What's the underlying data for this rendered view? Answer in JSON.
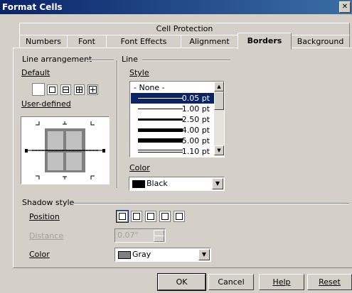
{
  "window": {
    "title": "Format Cells",
    "close_glyph": "✕"
  },
  "tabs_top": [
    {
      "label": "Cell Protection"
    }
  ],
  "tabs": [
    {
      "label": "Numbers"
    },
    {
      "label": "Font"
    },
    {
      "label": "Font Effects"
    },
    {
      "label": "Alignment"
    },
    {
      "label": "Borders",
      "active": true
    },
    {
      "label": "Background"
    }
  ],
  "line_arrangement": {
    "group_label": "Line arrangement",
    "default_label": "Default",
    "user_defined_label": "User-defined",
    "presets": [
      "none",
      "box",
      "top-bottom",
      "all",
      "outer-inner"
    ]
  },
  "line": {
    "group_label": "Line",
    "style_label": "Style",
    "styles": [
      {
        "label": "- None -"
      },
      {
        "label": "0.05 pt",
        "selected": true
      },
      {
        "label": "1.00 pt"
      },
      {
        "label": "2.50 pt"
      },
      {
        "label": "4.00 pt"
      },
      {
        "label": "5.00 pt"
      },
      {
        "label": "1.10 pt"
      }
    ],
    "color_label": "Color",
    "color_value": "Black",
    "color_hex": "#000000"
  },
  "shadow": {
    "group_label": "Shadow style",
    "position_label": "Position",
    "positions": [
      "none",
      "bottom-right",
      "top-right",
      "bottom-left",
      "top-left"
    ],
    "distance_label": "Distance",
    "distance_value": "0.07\"",
    "color_label": "Color",
    "color_value": "Gray",
    "color_hex": "#808080"
  },
  "buttons": {
    "ok": "OK",
    "cancel": "Cancel",
    "help": "Help",
    "reset": "Reset"
  },
  "colors": {
    "titlebar": "#0a246a",
    "selection": "#0a246a",
    "face": "#d4d0c8"
  }
}
